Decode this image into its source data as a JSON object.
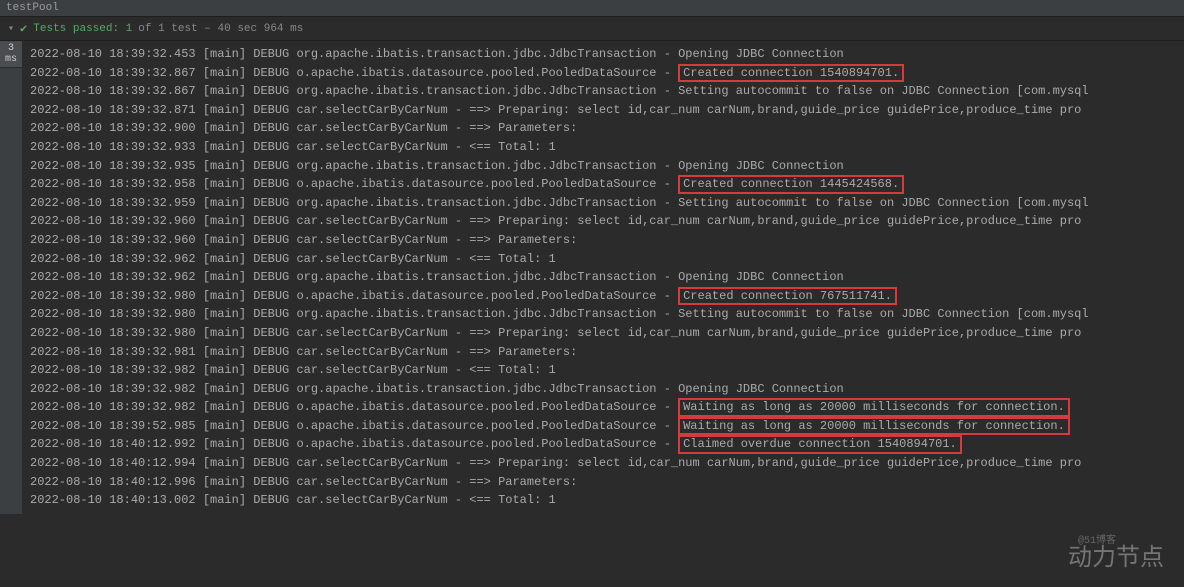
{
  "header": {
    "title": "testPool"
  },
  "toolbar": {
    "tests_passed_label": "Tests passed: 1",
    "tests_info": " of 1 test – 40 sec 964 ms"
  },
  "sidebar": {
    "tab_ms": "3 ms"
  },
  "log_lines": [
    {
      "text": "2022-08-10 18:39:32.453 [main] DEBUG org.apache.ibatis.transaction.jdbc.JdbcTransaction - Opening JDBC Connection"
    },
    {
      "prefix": "2022-08-10 18:39:32.867 [main] DEBUG o.apache.ibatis.datasource.pooled.PooledDataSource - ",
      "highlight": "Created connection 1540894701."
    },
    {
      "text": "2022-08-10 18:39:32.867 [main] DEBUG org.apache.ibatis.transaction.jdbc.JdbcTransaction - Setting autocommit to false on JDBC Connection [com.mysql"
    },
    {
      "text": "2022-08-10 18:39:32.871 [main] DEBUG car.selectCarByCarNum - ==>  Preparing: select id,car_num carNum,brand,guide_price guidePrice,produce_time pro"
    },
    {
      "text": "2022-08-10 18:39:32.900 [main] DEBUG car.selectCarByCarNum - ==> Parameters:"
    },
    {
      "text": "2022-08-10 18:39:32.933 [main] DEBUG car.selectCarByCarNum - <==      Total: 1"
    },
    {
      "text": "2022-08-10 18:39:32.935 [main] DEBUG org.apache.ibatis.transaction.jdbc.JdbcTransaction - Opening JDBC Connection"
    },
    {
      "prefix": "2022-08-10 18:39:32.958 [main] DEBUG o.apache.ibatis.datasource.pooled.PooledDataSource - ",
      "highlight": "Created connection 1445424568."
    },
    {
      "text": "2022-08-10 18:39:32.959 [main] DEBUG org.apache.ibatis.transaction.jdbc.JdbcTransaction - Setting autocommit to false on JDBC Connection [com.mysql"
    },
    {
      "text": "2022-08-10 18:39:32.960 [main] DEBUG car.selectCarByCarNum - ==>  Preparing: select id,car_num carNum,brand,guide_price guidePrice,produce_time pro"
    },
    {
      "text": "2022-08-10 18:39:32.960 [main] DEBUG car.selectCarByCarNum - ==> Parameters:"
    },
    {
      "text": "2022-08-10 18:39:32.962 [main] DEBUG car.selectCarByCarNum - <==      Total: 1"
    },
    {
      "text": "2022-08-10 18:39:32.962 [main] DEBUG org.apache.ibatis.transaction.jdbc.JdbcTransaction - Opening JDBC Connection"
    },
    {
      "prefix": "2022-08-10 18:39:32.980 [main] DEBUG o.apache.ibatis.datasource.pooled.PooledDataSource - ",
      "highlight": "Created connection 767511741."
    },
    {
      "text": "2022-08-10 18:39:32.980 [main] DEBUG org.apache.ibatis.transaction.jdbc.JdbcTransaction - Setting autocommit to false on JDBC Connection [com.mysql"
    },
    {
      "text": "2022-08-10 18:39:32.980 [main] DEBUG car.selectCarByCarNum - ==>  Preparing: select id,car_num carNum,brand,guide_price guidePrice,produce_time pro"
    },
    {
      "text": "2022-08-10 18:39:32.981 [main] DEBUG car.selectCarByCarNum - ==> Parameters:"
    },
    {
      "text": "2022-08-10 18:39:32.982 [main] DEBUG car.selectCarByCarNum - <==      Total: 1"
    },
    {
      "text": "2022-08-10 18:39:32.982 [main] DEBUG org.apache.ibatis.transaction.jdbc.JdbcTransaction - Opening JDBC Connection"
    },
    {
      "prefix": "2022-08-10 18:39:32.982 [main] DEBUG o.apache.ibatis.datasource.pooled.PooledDataSource - ",
      "highlight": "Waiting as long as 20000 milliseconds for connection."
    },
    {
      "prefix": "2022-08-10 18:39:52.985 [main] DEBUG o.apache.ibatis.datasource.pooled.PooledDataSource - ",
      "highlight": "Waiting as long as 20000 milliseconds for connection."
    },
    {
      "prefix": "2022-08-10 18:40:12.992 [main] DEBUG o.apache.ibatis.datasource.pooled.PooledDataSource - ",
      "highlight": "Claimed overdue connection 1540894701."
    },
    {
      "text": "2022-08-10 18:40:12.994 [main] DEBUG car.selectCarByCarNum - ==>  Preparing: select id,car_num carNum,brand,guide_price guidePrice,produce_time pro"
    },
    {
      "text": "2022-08-10 18:40:12.996 [main] DEBUG car.selectCarByCarNum - ==> Parameters:"
    },
    {
      "text": "2022-08-10 18:40:13.002 [main] DEBUG car.selectCarByCarNum - <==      Total: 1"
    }
  ],
  "watermark": "动力节点",
  "watermark_sub": "@51博客"
}
